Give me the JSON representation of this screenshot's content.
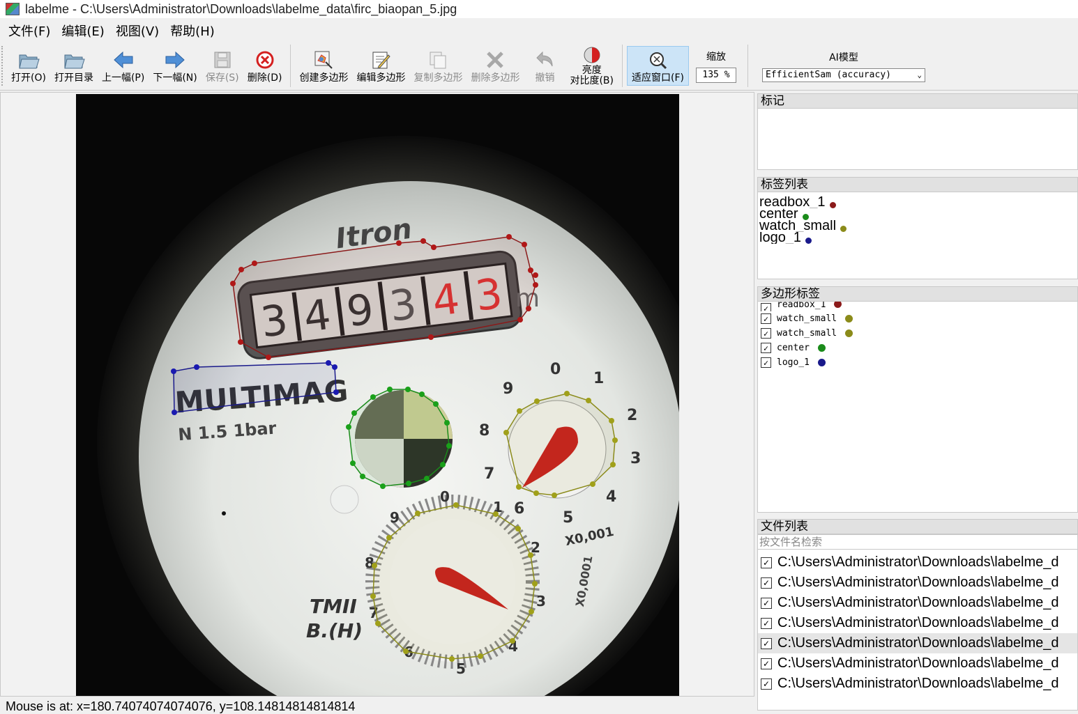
{
  "window": {
    "title": "labelme - C:\\Users\\Administrator\\Downloads\\labelme_data\\firc_biaopan_5.jpg"
  },
  "menu": [
    "文件(F)",
    "编辑(E)",
    "视图(V)",
    "帮助(H)"
  ],
  "toolbar": {
    "open": "打开(O)",
    "open_dir": "打开目录",
    "prev": "上一幅(P)",
    "next": "下一幅(N)",
    "save": "保存(S)",
    "delete": "删除(D)",
    "create_polygon": "创建多边形",
    "edit_polygon": "编辑多边形",
    "copy_polygon": "复制多边形",
    "delete_polygon": "删除多边形",
    "undo": "撤销",
    "brightness_1": "亮度",
    "brightness_2": "对比度(B)",
    "fit_window": "适应窗口(F)",
    "zoom_label": "缩放",
    "zoom_value": "135 %",
    "ai_label": "AI模型",
    "ai_model": "EfficientSam (accuracy)"
  },
  "docks": {
    "flags_title": "标记",
    "labels_title": "标签列表",
    "labels": [
      {
        "text": "readbox_1",
        "color": "#8b1a1a"
      },
      {
        "text": "center",
        "color": "#1a8b1a"
      },
      {
        "text": "watch_small",
        "color": "#8b8b1a"
      },
      {
        "text": "logo_1",
        "color": "#1a1a8b"
      }
    ],
    "polygons_title": "多边形标签",
    "polygons": [
      {
        "text": "readbox_1",
        "color": "#8b1a1a",
        "checked": "✓"
      },
      {
        "text": "watch_small",
        "color": "#8b8b1a",
        "checked": "✓"
      },
      {
        "text": "watch_small",
        "color": "#8b8b1a",
        "checked": "✓"
      },
      {
        "text": "center",
        "color": "#1a8b1a",
        "checked": "✓"
      },
      {
        "text": "logo_1",
        "color": "#1a1a8b",
        "checked": "✓"
      }
    ],
    "files_title": "文件列表",
    "files_search_placeholder": "按文件名检索",
    "files": [
      "C:\\Users\\Administrator\\Downloads\\labelme_d",
      "C:\\Users\\Administrator\\Downloads\\labelme_d",
      "C:\\Users\\Administrator\\Downloads\\labelme_d",
      "C:\\Users\\Administrator\\Downloads\\labelme_d",
      "C:\\Users\\Administrator\\Downloads\\labelme_d",
      "C:\\Users\\Administrator\\Downloads\\labelme_d",
      "C:\\Users\\Administrator\\Downloads\\labelme_d"
    ],
    "file_check": "✓"
  },
  "photo": {
    "brand": "Itron",
    "digits": [
      "3",
      "4",
      "9",
      "3",
      "4",
      "3"
    ],
    "unit": "m",
    "logo": "MULTIMAG",
    "spec": "N 1.5  1bar",
    "small_dial_nums": [
      "0",
      "1",
      "2",
      "3",
      "4",
      "5",
      "6",
      "7",
      "8",
      "9"
    ],
    "small_dial_mult": "X0,001",
    "big_dial_nums": [
      "0",
      "1",
      "2",
      "3",
      "4",
      "5",
      "6",
      "7",
      "8",
      "9"
    ],
    "big_dial_mult": "X0,0001",
    "tmii": "TMII",
    "bh": "B.(H)"
  },
  "status": "Mouse is at: x=180.74074074074076, y=108.14814814814814"
}
